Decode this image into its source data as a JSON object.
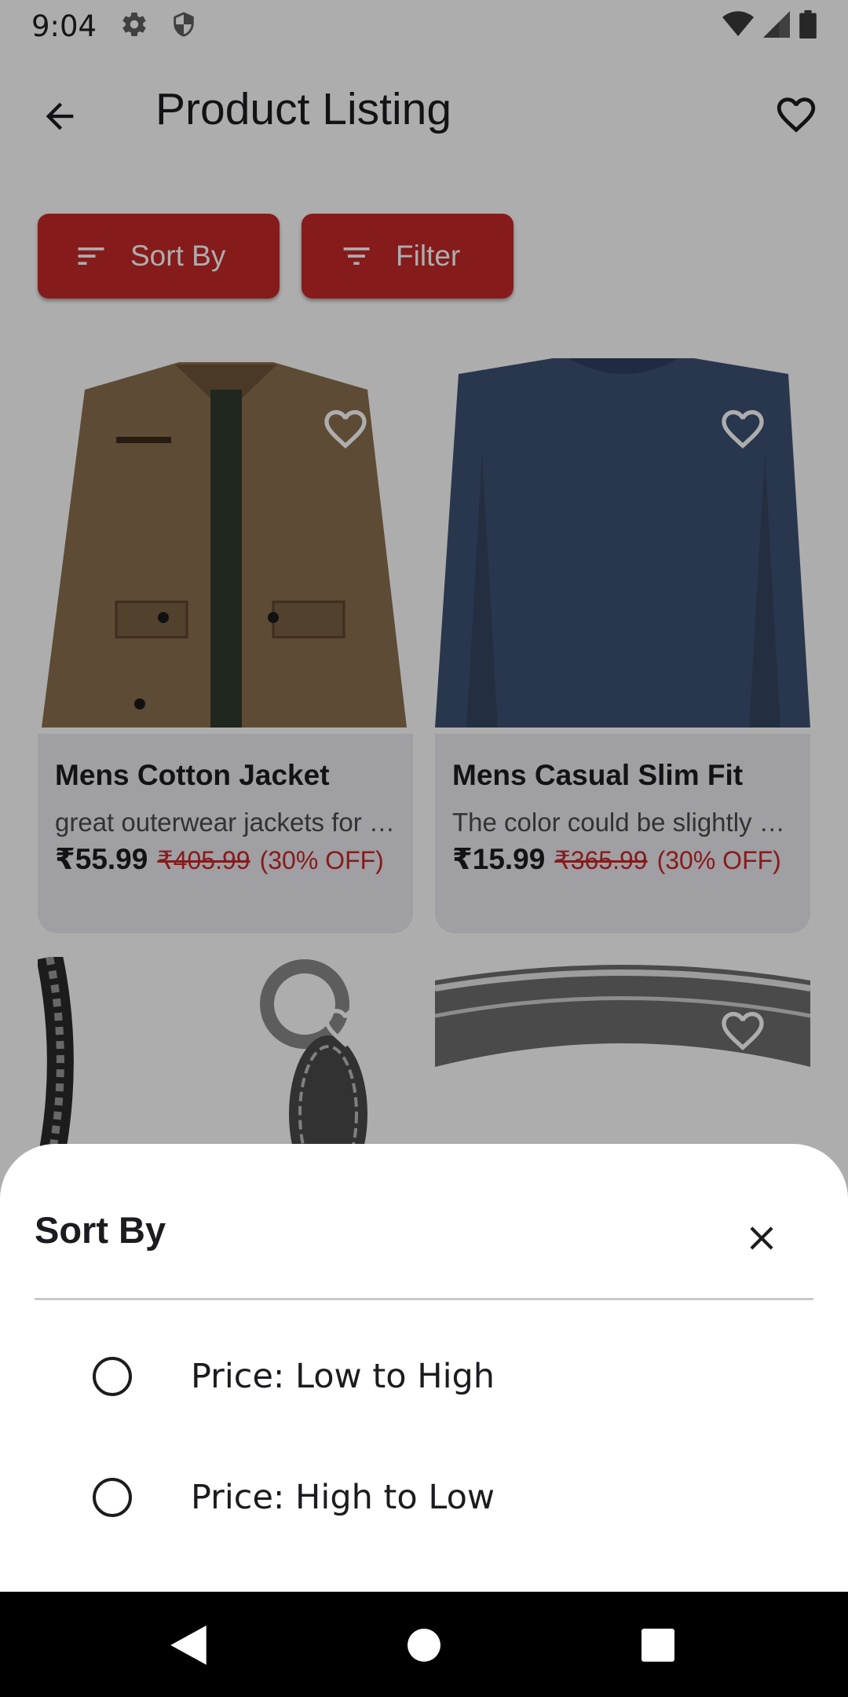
{
  "status_bar": {
    "time": "9:04"
  },
  "app_bar": {
    "title": "Product Listing"
  },
  "actions": {
    "sort_label": "Sort By",
    "filter_label": "Filter"
  },
  "products": [
    {
      "title": "Mens Cotton Jacket",
      "description": "great outerwear jackets for Spring/Autumn/Winter",
      "price": "₹55.99",
      "mrp": "₹405.99",
      "discount": "(30% OFF)"
    },
    {
      "title": "Mens Casual Slim Fit",
      "description": "The color could be slightly different between on the screen",
      "price": "₹15.99",
      "mrp": "₹365.99",
      "discount": "(30% OFF)"
    }
  ],
  "sort_sheet": {
    "title": "Sort By",
    "options": [
      {
        "label": "Price: Low to High",
        "selected": false
      },
      {
        "label": "Price: High to Low",
        "selected": false
      }
    ]
  },
  "colors": {
    "accent": "#c62828",
    "card_bg": "#ecebf1",
    "scrim": "rgba(0,0,0,0.32)"
  }
}
